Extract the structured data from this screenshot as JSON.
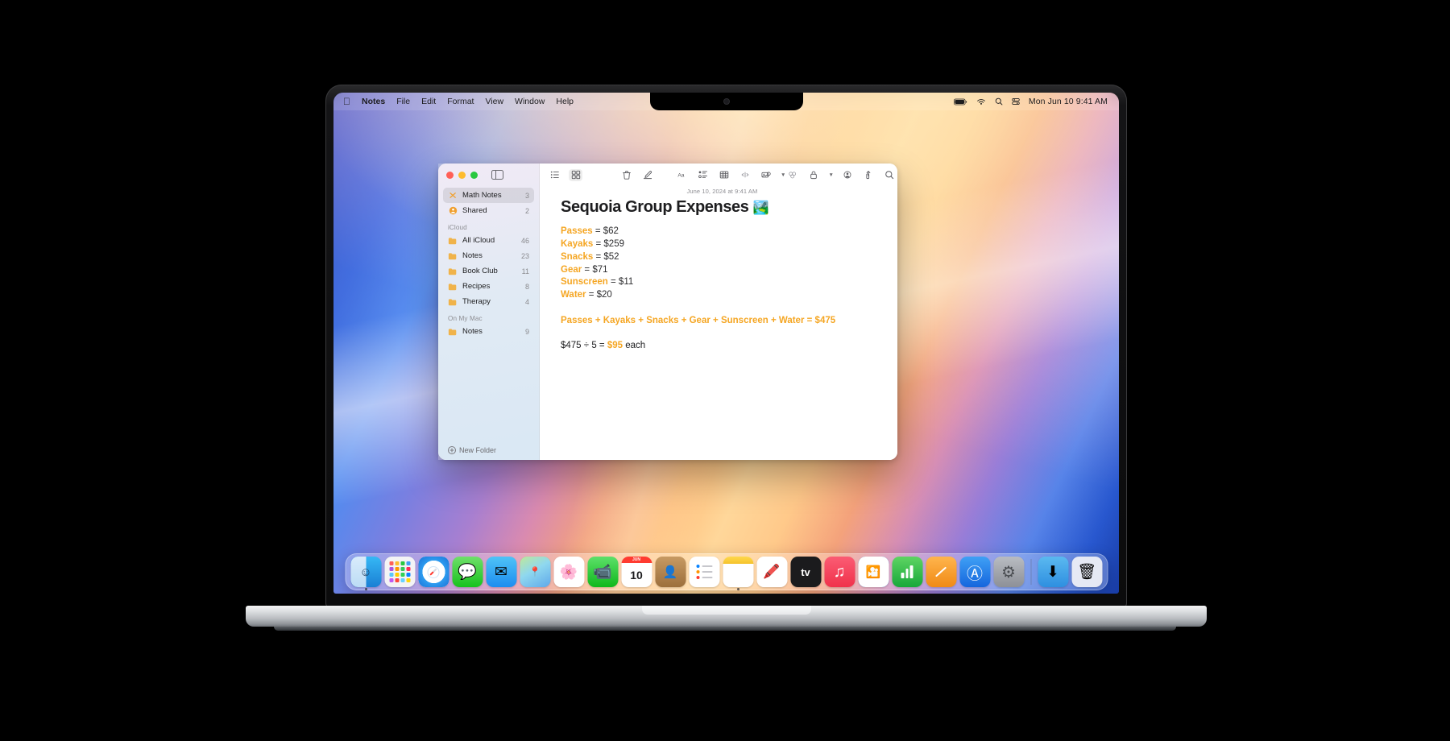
{
  "menubar": {
    "apple_icon": "apple-logo",
    "items": [
      {
        "label": "Notes",
        "bold": true
      },
      {
        "label": "File",
        "bold": false
      },
      {
        "label": "Edit",
        "bold": false
      },
      {
        "label": "Format",
        "bold": false
      },
      {
        "label": "View",
        "bold": false
      },
      {
        "label": "Window",
        "bold": false
      },
      {
        "label": "Help",
        "bold": false
      }
    ],
    "status_icons": [
      "battery-icon",
      "wifi-icon",
      "search-icon",
      "control-center-icon"
    ],
    "clock": "Mon Jun 10  9:41 AM"
  },
  "window": {
    "traffic_lights": [
      "close-button",
      "minimize-button",
      "zoom-button"
    ],
    "sidebar_toggle": "sidebar-toggle-icon"
  },
  "sidebar": {
    "pinned": [
      {
        "label": "Math Notes",
        "count": "3",
        "icon": "math-notes-icon",
        "selected": true
      },
      {
        "label": "Shared",
        "count": "2",
        "icon": "shared-icon",
        "selected": false
      }
    ],
    "sections": [
      {
        "title": "iCloud",
        "items": [
          {
            "label": "All iCloud",
            "count": "46",
            "icon": "folder-icon"
          },
          {
            "label": "Notes",
            "count": "23",
            "icon": "folder-icon"
          },
          {
            "label": "Book Club",
            "count": "11",
            "icon": "folder-icon"
          },
          {
            "label": "Recipes",
            "count": "8",
            "icon": "folder-icon"
          },
          {
            "label": "Therapy",
            "count": "4",
            "icon": "folder-icon"
          }
        ]
      },
      {
        "title": "On My Mac",
        "items": [
          {
            "label": "Notes",
            "count": "9",
            "icon": "folder-icon"
          }
        ]
      }
    ],
    "new_folder_label": "New Folder"
  },
  "toolbar": {
    "left": [
      {
        "name": "list-view-icon",
        "active": false
      },
      {
        "name": "gallery-view-icon",
        "active": true
      }
    ],
    "middle": [
      {
        "name": "trash-icon"
      },
      {
        "name": "compose-note-icon"
      }
    ],
    "format": [
      {
        "name": "text-format-icon",
        "label": "Aa"
      },
      {
        "name": "checklist-icon"
      },
      {
        "name": "table-icon"
      },
      {
        "name": "link-icon"
      },
      {
        "name": "media-icon",
        "has_chevron": true
      }
    ],
    "right": [
      {
        "name": "collaborate-icon"
      },
      {
        "name": "lock-icon",
        "has_chevron": true
      },
      {
        "name": "add-people-icon"
      },
      {
        "name": "share-icon"
      },
      {
        "name": "search-icon"
      }
    ]
  },
  "note": {
    "date": "June 10, 2024 at 9:41 AM",
    "title": "Sequoia Group Expenses",
    "title_emoji": "🏞️",
    "expenses": [
      {
        "name": "Passes",
        "eq": " = ",
        "value": "$62"
      },
      {
        "name": "Kayaks",
        "eq": " = ",
        "value": "$259"
      },
      {
        "name": "Snacks",
        "eq": " = ",
        "value": "$52"
      },
      {
        "name": "Gear",
        "eq": " = ",
        "value": "$71"
      },
      {
        "name": "Sunscreen",
        "eq": " = ",
        "value": "$11"
      },
      {
        "name": "Water",
        "eq": " = ",
        "value": "$20"
      }
    ],
    "sum_terms": [
      "Passes",
      "Kayaks",
      "Snacks",
      "Gear",
      "Sunscreen",
      "Water"
    ],
    "sum_operator": "+",
    "sum_equals": "=",
    "sum_total": "$475",
    "division": {
      "dividend": "$475",
      "operator": "÷",
      "divisor": "5",
      "equals": "=",
      "result": "$95",
      "suffix": "each"
    }
  },
  "dock": {
    "apps": [
      {
        "name": "finder",
        "glyph": "🙂",
        "bg": "linear-gradient(180deg,#36b8f5 0%,#1a7fd4 100%)",
        "running": true
      },
      {
        "name": "launchpad",
        "glyph": "⠿",
        "bg": "#f3f3f5",
        "running": false
      },
      {
        "name": "safari",
        "glyph": "🧭",
        "bg": "linear-gradient(180deg,#f2f7fb 0%,#d8e6f2 100%)",
        "running": false
      },
      {
        "name": "messages",
        "glyph": "💬",
        "bg": "linear-gradient(180deg,#6fe06a 0%,#16c21e 100%)",
        "running": false
      },
      {
        "name": "mail",
        "glyph": "✉",
        "bg": "linear-gradient(180deg,#4fc3f7 0%,#1d8df0 100%)",
        "running": false
      },
      {
        "name": "maps",
        "glyph": "🗺",
        "bg": "linear-gradient(180deg,#9fe37a 0%,#4fa0e8 100%)",
        "running": false
      },
      {
        "name": "photos",
        "glyph": "🌸",
        "bg": "#fdfdfd",
        "running": false
      },
      {
        "name": "facetime",
        "glyph": "📹",
        "bg": "linear-gradient(180deg,#5de06a 0%,#0fb81c 100%)",
        "running": false
      },
      {
        "name": "calendar",
        "glyph": "10",
        "bg": "#ffffff",
        "running": false
      },
      {
        "name": "contacts",
        "glyph": "👤",
        "bg": "linear-gradient(180deg,#c79a63 0%,#9c6f3c 100%)",
        "running": false
      },
      {
        "name": "reminders",
        "glyph": "☰",
        "bg": "#ffffff",
        "running": false
      },
      {
        "name": "notes",
        "glyph": "📒",
        "bg": "linear-gradient(180deg,#ffd84d 0%,#fff8e0 22%,#ffffff 100%)",
        "running": true
      },
      {
        "name": "freeform",
        "glyph": "〰",
        "bg": "#ffffff",
        "running": false
      },
      {
        "name": "appletv",
        "glyph": "tv",
        "bg": "#1b1b1d",
        "running": false
      },
      {
        "name": "music",
        "glyph": "♫",
        "bg": "linear-gradient(180deg,#fb5c74 0%,#f0324b 100%)",
        "running": false
      },
      {
        "name": "keynote",
        "glyph": "🎤",
        "bg": "linear-gradient(180deg,#59a7ef 0%,#1f74d6 100%)",
        "running": false
      },
      {
        "name": "numbers",
        "glyph": "📊",
        "bg": "linear-gradient(180deg,#5ed463 0%,#17a83a 100%)",
        "running": false
      },
      {
        "name": "pages",
        "glyph": "✎",
        "bg": "linear-gradient(180deg,#ffb54d 0%,#f08a16 100%)",
        "running": false
      },
      {
        "name": "app-store",
        "glyph": "Ⓐ",
        "bg": "linear-gradient(180deg,#3fa0f5 0%,#1566dd 100%)",
        "running": false
      },
      {
        "name": "system-settings",
        "glyph": "⚙",
        "bg": "linear-gradient(180deg,#b9bcc2 0%,#8d9097 100%)",
        "running": false
      }
    ],
    "separator": true,
    "trailing": [
      {
        "name": "downloads-folder",
        "glyph": "⬇",
        "bg": "linear-gradient(180deg,#5bb9f0 0%,#2e8fe0 100%)"
      },
      {
        "name": "trash",
        "glyph": "🗑",
        "bg": "rgba(245,245,247,0.9)"
      }
    ]
  },
  "colors": {
    "accent_orange": "#f5a623",
    "text_primary": "#1d1d1f",
    "text_secondary": "#8e8e93"
  }
}
